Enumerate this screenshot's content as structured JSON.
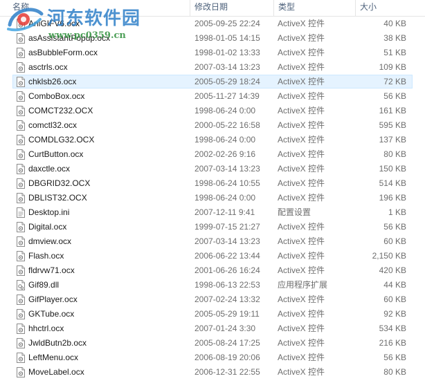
{
  "columns": {
    "name": "名称",
    "date": "修改日期",
    "type": "类型",
    "size": "大小"
  },
  "watermark": {
    "title": "河东软件园",
    "url": "www.pc0359.cn"
  },
  "files": [
    {
      "name": "AniGIFV6.ocx",
      "date": "2005-09-25 22:24",
      "type": "ActiveX 控件",
      "size": "40 KB",
      "icon": "ocx-file-icon"
    },
    {
      "name": "asAssistantPopup.ocx",
      "date": "1998-01-05 14:15",
      "type": "ActiveX 控件",
      "size": "38 KB",
      "icon": "ocx-file-icon"
    },
    {
      "name": "asBubbleForm.ocx",
      "date": "1998-01-02 13:33",
      "type": "ActiveX 控件",
      "size": "51 KB",
      "icon": "ocx-file-icon"
    },
    {
      "name": "asctrls.ocx",
      "date": "2007-03-14 13:23",
      "type": "ActiveX 控件",
      "size": "109 KB",
      "icon": "ocx-file-icon"
    },
    {
      "name": "chklsb26.ocx",
      "date": "2005-05-29 18:24",
      "type": "ActiveX 控件",
      "size": "72 KB",
      "icon": "ocx-file-icon"
    },
    {
      "name": "ComboBox.ocx",
      "date": "2005-11-27 14:39",
      "type": "ActiveX 控件",
      "size": "56 KB",
      "icon": "ocx-file-icon"
    },
    {
      "name": "COMCT232.OCX",
      "date": "1998-06-24 0:00",
      "type": "ActiveX 控件",
      "size": "161 KB",
      "icon": "ocx-file-icon"
    },
    {
      "name": "comctl32.ocx",
      "date": "2000-05-22 16:58",
      "type": "ActiveX 控件",
      "size": "595 KB",
      "icon": "ocx-file-icon"
    },
    {
      "name": "COMDLG32.OCX",
      "date": "1998-06-24 0:00",
      "type": "ActiveX 控件",
      "size": "137 KB",
      "icon": "ocx-file-icon"
    },
    {
      "name": "CurtButton.ocx",
      "date": "2002-02-26 9:16",
      "type": "ActiveX 控件",
      "size": "80 KB",
      "icon": "ocx-file-icon"
    },
    {
      "name": "daxctle.ocx",
      "date": "2007-03-14 13:23",
      "type": "ActiveX 控件",
      "size": "150 KB",
      "icon": "ocx-file-icon"
    },
    {
      "name": "DBGRID32.OCX",
      "date": "1998-06-24 10:55",
      "type": "ActiveX 控件",
      "size": "514 KB",
      "icon": "ocx-file-icon"
    },
    {
      "name": "DBLIST32.OCX",
      "date": "1998-06-24 0:00",
      "type": "ActiveX 控件",
      "size": "196 KB",
      "icon": "ocx-file-icon"
    },
    {
      "name": "Desktop.ini",
      "date": "2007-12-11 9:41",
      "type": "配置设置",
      "size": "1 KB",
      "icon": "ini-file-icon"
    },
    {
      "name": "Digital.ocx",
      "date": "1999-07-15 21:27",
      "type": "ActiveX 控件",
      "size": "56 KB",
      "icon": "ocx-file-icon"
    },
    {
      "name": "dmview.ocx",
      "date": "2007-03-14 13:23",
      "type": "ActiveX 控件",
      "size": "60 KB",
      "icon": "ocx-file-icon"
    },
    {
      "name": "Flash.ocx",
      "date": "2006-06-22 13:44",
      "type": "ActiveX 控件",
      "size": "2,150 KB",
      "icon": "ocx-file-icon"
    },
    {
      "name": "fldrvw71.ocx",
      "date": "2001-06-26 16:24",
      "type": "ActiveX 控件",
      "size": "420 KB",
      "icon": "ocx-file-icon"
    },
    {
      "name": "Gif89.dll",
      "date": "1998-06-13 22:53",
      "type": "应用程序扩展",
      "size": "44 KB",
      "icon": "dll-file-icon"
    },
    {
      "name": "GifPlayer.ocx",
      "date": "2007-02-24 13:32",
      "type": "ActiveX 控件",
      "size": "60 KB",
      "icon": "ocx-file-icon"
    },
    {
      "name": "GKTube.ocx",
      "date": "2005-05-29 19:11",
      "type": "ActiveX 控件",
      "size": "92 KB",
      "icon": "ocx-file-icon"
    },
    {
      "name": "hhctrl.ocx",
      "date": "2007-01-24 3:30",
      "type": "ActiveX 控件",
      "size": "534 KB",
      "icon": "ocx-file-icon"
    },
    {
      "name": "JwldButn2b.ocx",
      "date": "2005-08-24 17:25",
      "type": "ActiveX 控件",
      "size": "216 KB",
      "icon": "ocx-file-icon"
    },
    {
      "name": "LeftMenu.ocx",
      "date": "2006-08-19 20:06",
      "type": "ActiveX 控件",
      "size": "56 KB",
      "icon": "ocx-file-icon"
    },
    {
      "name": "MoveLabel.ocx",
      "date": "2006-12-31 22:55",
      "type": "ActiveX 控件",
      "size": "80 KB",
      "icon": "ocx-file-icon"
    }
  ],
  "selected_index": 4,
  "colors": {
    "selection": "#e5f3ff",
    "selection_border": "#cce8ff",
    "header_text": "#4c607a",
    "watermark_title": "#2e7fc8",
    "watermark_url": "#2d8f3a"
  }
}
